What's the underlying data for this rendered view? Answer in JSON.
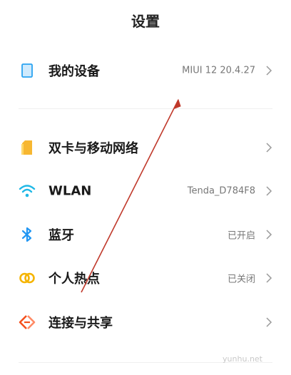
{
  "header": {
    "title": "设置"
  },
  "rows": [
    {
      "id": "my-device",
      "label": "我的设备",
      "value": "MIUI 12 20.4.27",
      "icon": "phone-icon",
      "icon_color": "#2aa3f0"
    },
    {
      "id": "sim",
      "label": "双卡与移动网络",
      "value": "",
      "icon": "sim-card-icon",
      "icon_color": "#f7b731"
    },
    {
      "id": "wlan",
      "label": "WLAN",
      "value": "Tenda_D784F8",
      "icon": "wifi-icon",
      "icon_color": "#1fb8e6"
    },
    {
      "id": "bluetooth",
      "label": "蓝牙",
      "value": "已开启",
      "icon": "bluetooth-icon",
      "icon_color": "#2196f3"
    },
    {
      "id": "hotspot",
      "label": "个人热点",
      "value": "已关闭",
      "icon": "hotspot-icon",
      "icon_color": "#f5b400"
    },
    {
      "id": "connection-sharing",
      "label": "连接与共享",
      "value": "",
      "icon": "connection-sharing-icon",
      "icon_color": "#f4511e"
    }
  ],
  "watermark": "yunhu.net",
  "annotation": {
    "arrow_color": "#c0392b"
  }
}
